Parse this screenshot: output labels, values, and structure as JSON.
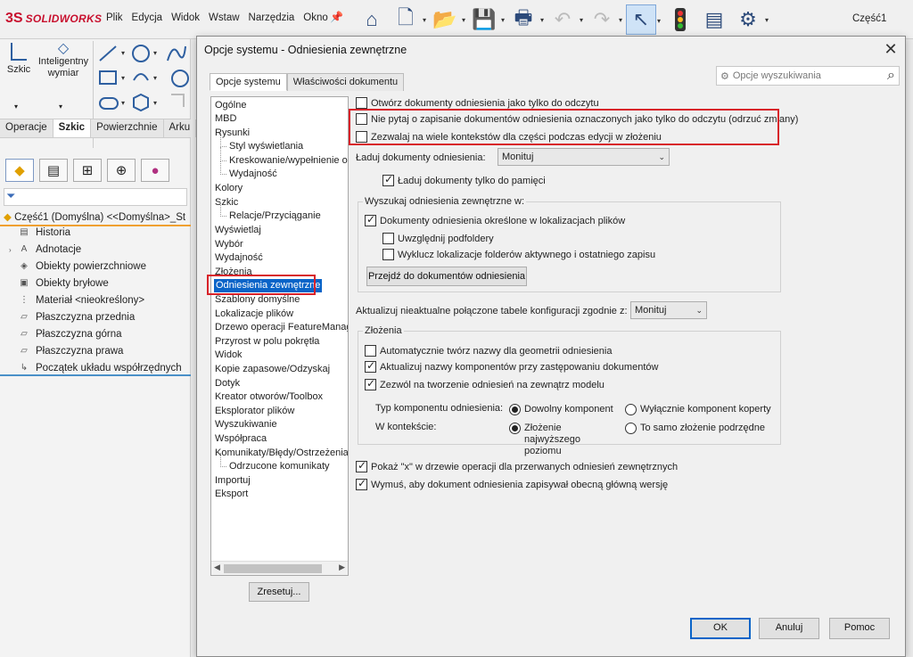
{
  "app": {
    "brand_symbol": "3S",
    "brand": "SOLIDWORKS",
    "menu": [
      "Plik",
      "Edycja",
      "Widok",
      "Wstaw",
      "Narzędzia",
      "Okno"
    ],
    "document_title": "Część1"
  },
  "toolbar_icons": [
    "home-icon",
    "new-document-icon",
    "open-icon",
    "save-icon",
    "print-icon",
    "undo-icon",
    "redo-icon",
    "select-icon",
    "rebuild-icon",
    "file-properties-icon",
    "options-icon"
  ],
  "sketch_tools": {
    "sketch_label": "Szkic",
    "smart_dim_label": "Inteligentny wymiar"
  },
  "command_tabs": [
    "Operacje",
    "Szkic",
    "Powierzchnie",
    "Arku"
  ],
  "tree": {
    "root": "Część1 (Domyślna) <<Domyślna>_St",
    "items": [
      "Historia",
      "Adnotacje",
      "Obiekty powierzchniowe",
      "Obiekty bryłowe",
      "Materiał <nieokreślony>",
      "Płaszczyzna przednia",
      "Płaszczyzna górna",
      "Płaszczyzna prawa",
      "Początek układu współrzędnych"
    ]
  },
  "dialog": {
    "title": "Opcje systemu - Odniesienia zewnętrzne",
    "tabs": [
      "Opcje systemu",
      "Właściwości dokumentu"
    ],
    "search_placeholder": "Opcje wyszukiwania",
    "categories": [
      "Ogólne",
      "MBD",
      "Rysunki",
      "Styl wyświetlania",
      "Kreskowanie/wypełnienie obs",
      "Wydajność",
      "Kolory",
      "Szkic",
      "Relacje/Przyciąganie",
      "Wyświetlaj",
      "Wybór",
      "Wydajność",
      "Złożenia",
      "Odniesienia zewnętrzne",
      "Szablony domyślne",
      "Lokalizacje plików",
      "Drzewo operacji FeatureManage",
      "Przyrost w polu pokrętła",
      "Widok",
      "Kopie zapasowe/Odzyskaj",
      "Dotyk",
      "Kreator otworów/Toolbox",
      "Eksplorator plików",
      "Wyszukiwanie",
      "Współpraca",
      "Komunikaty/Błędy/Ostrzeżenia",
      "Odrzucone komunikaty",
      "Importuj",
      "Eksport"
    ],
    "reset_label": "Zresetuj...",
    "options": {
      "open_readonly": "Otwórz dokumenty odniesienia jako tylko do odczytu",
      "dont_prompt_save": "Nie pytaj o zapisanie dokumentów odniesienia oznaczonych jako tylko do odczytu (odrzuć zmiany)",
      "multiple_contexts": "Zezwalaj na wiele kontekstów dla części podczas edycji w złożeniu",
      "load_label": "Ładuj dokumenty odniesienia:",
      "load_value": "Monituj",
      "load_memory_only": "Ładuj dokumenty tylko do pamięci",
      "search_group": "Wyszukaj odniesienia zewnętrzne w:",
      "docs_in_locations": "Dokumenty odniesienia określone w lokalizacjach plików",
      "include_subfolders": "Uwzględnij podfoldery",
      "exclude_active": "Wyklucz lokalizacje folderów aktywnego i ostatniego zapisu",
      "goto_btn": "Przejdź do dokumentów odniesienia",
      "update_tables_label": "Aktualizuj nieaktualne połączone tabele konfiguracji zgodnie z:",
      "update_tables_value": "Monituj",
      "assemblies_group": "Złożenia",
      "auto_names": "Automatycznie twórz nazwy dla geometrii odniesienia",
      "update_names": "Aktualizuj nazwy komponentów przy zastępowaniu dokumentów",
      "allow_external": "Zezwól na tworzenie odniesień na zewnątrz modelu",
      "ref_comp_type": "Typ komponentu odniesienia:",
      "any_component": "Dowolny komponent",
      "envelope_only": "Wyłącznie komponent koperty",
      "in_context": "W kontekście:",
      "top_level": "Złożenie najwyższego poziomu",
      "same_sub": "To samo złożenie podrzędne",
      "show_x": "Pokaż \"x\" w drzewie operacji dla przerwanych odniesień zewnętrznych",
      "force_save": "Wymuś, aby dokument odniesienia zapisywał obecną główną wersję"
    },
    "buttons": {
      "ok": "OK",
      "cancel": "Anuluj",
      "help": "Pomoc"
    }
  }
}
